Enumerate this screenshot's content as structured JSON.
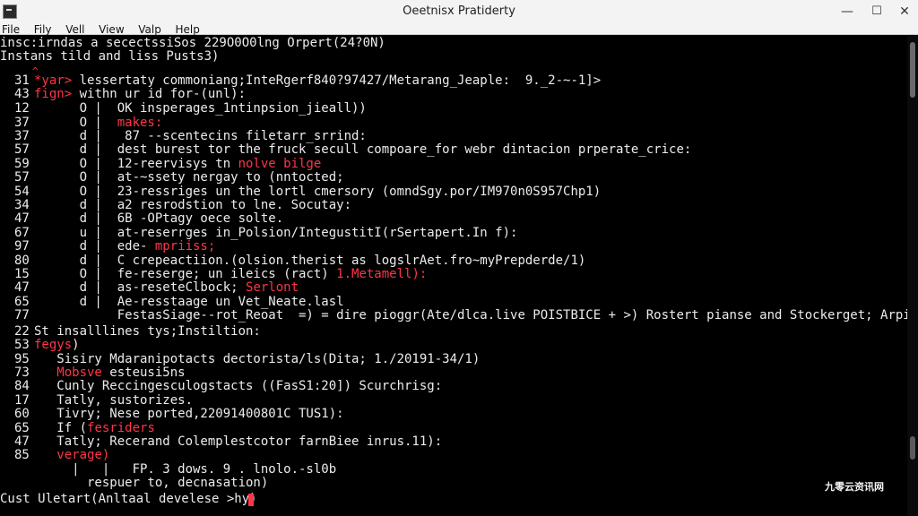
{
  "window": {
    "title": "Oeetnisx Pratiderty",
    "controls": {
      "minimize": "—",
      "maximize": "☐",
      "close": "✕"
    }
  },
  "menu": [
    "File",
    "Fily",
    "Vell",
    "View",
    "Valp",
    "Help"
  ],
  "terminal": {
    "header_lines": [
      "insc:irndas a secectssiSos 229O0O0lng Orpert(24?0N)",
      "Instans tild and liss Pusts3)"
    ],
    "marker": "^",
    "line_numbers": [
      "31",
      "43",
      "12",
      "37",
      "37",
      "57",
      "59",
      "57",
      "54",
      "34",
      "47",
      "67",
      "97",
      "80",
      "15",
      "47",
      "65",
      "77",
      "22",
      "53",
      "95",
      "73",
      "84",
      "17",
      "60",
      "65",
      "47",
      "85"
    ],
    "code_lines": [
      {
        "prefix": "*yar>",
        "text": " lessertaty commoniang;InteRgerf840?97427/Metarang_Jeaple:  9._2-~-1]>"
      },
      {
        "prefix": "fign>",
        "text": " withn ur id for-(unl):"
      },
      {
        "prefix": "",
        "text": "      O |  OK insperages_1ntinpsion_jieall))"
      },
      {
        "prefix": "",
        "text": "      O |  ",
        "red_text": "makes:"
      },
      {
        "prefix": "",
        "text": "      d |   87 --scentecins filetarr_srrind:"
      },
      {
        "prefix": "",
        "text": "      d |  dest burest tor the fruck secull compoare_for webr dintacion prperate_crice:"
      },
      {
        "prefix": "",
        "text": "      O |  12-reervisys tn ",
        "red_text": "nolve bilge"
      },
      {
        "prefix": "",
        "text": "      O |  at-~ssety nergay to (nntocted;"
      },
      {
        "prefix": "",
        "text": "      O |  23-ressriges un the lortl cmersory (omndSgy.por/IM970n0S957Chp1)"
      },
      {
        "prefix": "",
        "text": "      d |  a2 resrodstion to lne. Socutay:"
      },
      {
        "prefix": "",
        "text": "      d |  6B -OPtagy oece solte."
      },
      {
        "prefix": "",
        "text": "      u |  at-reserrges in_Polsion/IntegustitI(rSertapert.In f):"
      },
      {
        "prefix": "",
        "text": "      d |  ede- ",
        "red_text": "mpriiss;"
      },
      {
        "prefix": "",
        "text": "      d |  C crepeactiion.(olsion.therist as logslrAet.fro~myPrepderde/1)"
      },
      {
        "prefix": "",
        "text": "      O |  fe-reserge; un ileics (ract) ",
        "red_text": "1.Metamell):"
      },
      {
        "prefix": "",
        "text": "      d |  as-reseteClbock; ",
        "red_text": "Serlont"
      },
      {
        "prefix": "",
        "text": "      d |  Ae-resstaage un Vet_Neate.lasl"
      },
      {
        "prefix": "",
        "text": "           FestasSiage--rot_Reoat  =) = dire pioggr(Ate/dlca.live POISTBICE + >) Rostert pianse and Stockerget; Arpiscrion:"
      }
    ],
    "section2": [
      {
        "prefix": "St",
        "text": " insalllines tys;Instiltion:"
      },
      {
        "prefix": "",
        "red_prefix": "fegys",
        "text": ")"
      },
      {
        "prefix": "",
        "text": "   Sisiry Mdaranipotacts dectorista/ls(Dita; 1./20191-34/1)"
      },
      {
        "prefix": "",
        "red_prefix": "   Mobsve",
        "text": " esteusi5ns"
      },
      {
        "prefix": "",
        "text": "   Cunly Reccingesculogstacts ((FasS1:20]) Scurchrisg:"
      },
      {
        "prefix": "",
        "text": "   Tatly, sustorizes."
      },
      {
        "prefix": "",
        "text": "   Tivry; Nese ported,22091400801C TUS1):"
      },
      {
        "prefix": "",
        "text": "   If (",
        "red_text": "fesriders"
      },
      {
        "prefix": "",
        "text": "   Tatly; Recerand Colemplestcotor farnBiee inrus.11):"
      },
      {
        "prefix": "",
        "text": "   ",
        "red_text": "verage)"
      },
      {
        "prefix": "",
        "text": "     |   |   FP. 3 dows. 9 . lnolo.-sl0b"
      },
      {
        "prefix": "",
        "text": "       respuer to, decnasation)"
      }
    ],
    "prompt": "Cust Uletart(Anltaal develese >hy)"
  },
  "watermark": "九零云资讯网",
  "colors": {
    "background": "#000000",
    "text": "#ececec",
    "accent_red": "#ff3548",
    "titlebar": "#f3f3f3"
  }
}
